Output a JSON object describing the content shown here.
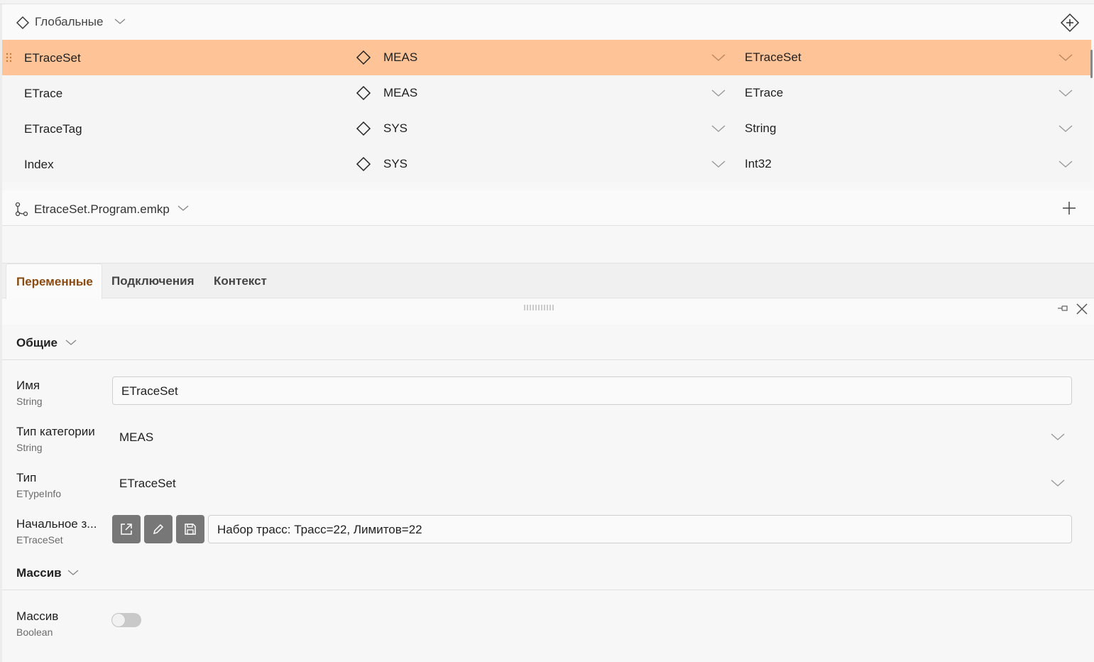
{
  "globals": {
    "title": "Глобальные"
  },
  "variables": [
    {
      "name": "ETraceSet",
      "category": "MEAS",
      "type": "ETraceSet",
      "selected": true
    },
    {
      "name": "ETrace",
      "category": "MEAS",
      "type": "ETrace",
      "selected": false
    },
    {
      "name": "ETraceTag",
      "category": "SYS",
      "type": "String",
      "selected": false
    },
    {
      "name": "Index",
      "category": "SYS",
      "type": "Int32",
      "selected": false
    }
  ],
  "program": {
    "title": "EtraceSet.Program.emkp"
  },
  "tabs": [
    {
      "label": "Переменные",
      "active": true
    },
    {
      "label": "Подключения",
      "active": false
    },
    {
      "label": "Контекст",
      "active": false
    }
  ],
  "sections": {
    "general": {
      "title": "Общие"
    },
    "array": {
      "title": "Массив"
    }
  },
  "properties": {
    "name": {
      "label": "Имя",
      "type": "String",
      "value": "ETraceSet"
    },
    "category": {
      "label": "Тип категории",
      "type": "String",
      "value": "MEAS"
    },
    "type": {
      "label": "Тип",
      "type": "ETypeInfo",
      "value": "ETraceSet"
    },
    "initial": {
      "label": "Начальное з...",
      "type": "ETraceSet",
      "value": "Набор трасс: Трасс=22, Лимитов=22"
    },
    "array": {
      "label": "Массив",
      "type": "Boolean",
      "value": false
    }
  },
  "colors": {
    "selected_row": "#fec397",
    "active_tab_text": "#8a4a10",
    "icon_button": "#777777"
  }
}
